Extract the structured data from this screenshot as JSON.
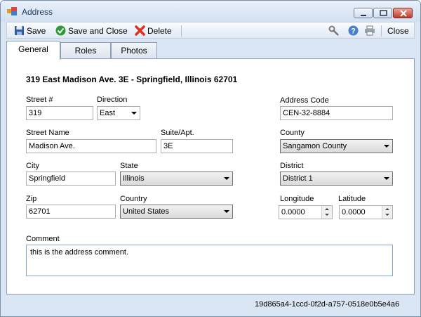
{
  "window": {
    "title": "Address"
  },
  "toolbar": {
    "save": "Save",
    "save_close": "Save and Close",
    "delete": "Delete",
    "close": "Close"
  },
  "tabs": [
    {
      "label": "General",
      "active": true
    },
    {
      "label": "Roles",
      "active": false
    },
    {
      "label": "Photos",
      "active": false
    }
  ],
  "form": {
    "heading": "319 East Madison Ave. 3E - Springfield, Illinois 62701",
    "street_no": {
      "label": "Street #",
      "value": "319"
    },
    "direction": {
      "label": "Direction",
      "value": "East"
    },
    "street_name": {
      "label": "Street Name",
      "value": "Madison Ave."
    },
    "suite": {
      "label": "Suite/Apt.",
      "value": "3E"
    },
    "city": {
      "label": "City",
      "value": "Springfield"
    },
    "state": {
      "label": "State",
      "value": "Illinois"
    },
    "zip": {
      "label": "Zip",
      "value": "62701"
    },
    "country": {
      "label": "Country",
      "value": "United States"
    },
    "address_code": {
      "label": "Address Code",
      "value": "CEN-32-8884"
    },
    "county": {
      "label": "County",
      "value": "Sangamon County"
    },
    "district": {
      "label": "District",
      "value": "District 1"
    },
    "longitude": {
      "label": "Longitude",
      "value": "0.0000"
    },
    "latitude": {
      "label": "Latitude",
      "value": "0.0000"
    },
    "comment": {
      "label": "Comment",
      "value": "this is the address comment."
    }
  },
  "footer": {
    "record_id": "19d865a4-1ccd-0f2d-a757-0518e0b5e4a6"
  },
  "colors": {
    "accent": "#1e395b",
    "frame": "#dbe6f4",
    "close": "#c0392b"
  }
}
